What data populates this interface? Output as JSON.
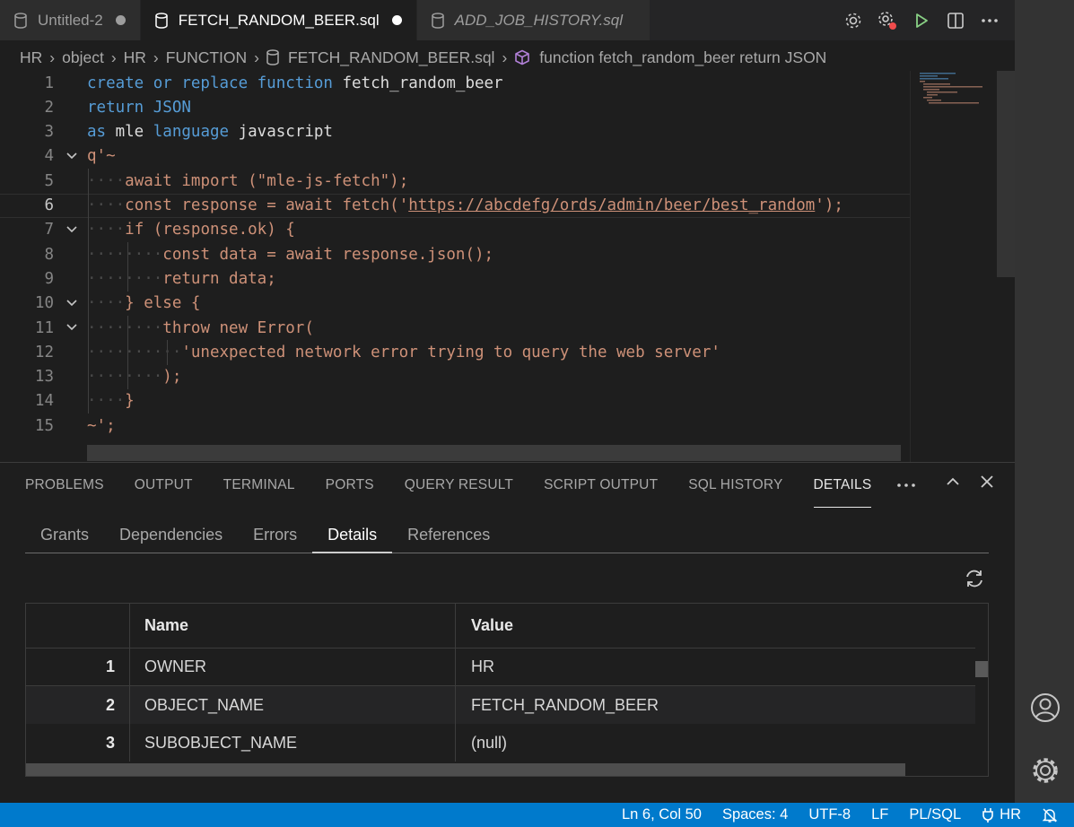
{
  "tabs": [
    {
      "label": "Untitled-2",
      "modified": true,
      "active": false,
      "italic": false
    },
    {
      "label": "FETCH_RANDOM_BEER.sql",
      "modified": true,
      "active": true,
      "italic": false
    },
    {
      "label": "ADD_JOB_HISTORY.sql",
      "modified": false,
      "active": false,
      "italic": true
    }
  ],
  "breadcrumb": {
    "items": [
      "HR",
      "object",
      "HR",
      "FUNCTION"
    ],
    "file": "FETCH_RANDOM_BEER.sql",
    "symbol": "function fetch_random_beer return JSON"
  },
  "editor": {
    "current_line": 6,
    "line_numbers": [
      "1",
      "2",
      "3",
      "4",
      "5",
      "6",
      "7",
      "8",
      "9",
      "10",
      "11",
      "12",
      "13",
      "14",
      "15"
    ],
    "lines": [
      [
        {
          "t": "create or replace function",
          "c": "kw"
        },
        {
          "t": " fetch_random_beer",
          "c": "id"
        }
      ],
      [
        {
          "t": "return JSON",
          "c": "kw"
        }
      ],
      [
        {
          "t": "as",
          "c": "kw"
        },
        {
          "t": " mle ",
          "c": "id"
        },
        {
          "t": "language",
          "c": "kw"
        },
        {
          "t": " javascript",
          "c": "id"
        }
      ],
      [
        {
          "t": "q'~",
          "c": "str"
        }
      ],
      [
        {
          "t": "····",
          "c": "ws"
        },
        {
          "t": "await import (\"mle-js-fetch\");",
          "c": "str"
        }
      ],
      [
        {
          "t": "····",
          "c": "ws"
        },
        {
          "t": "const response = await fetch('",
          "c": "str"
        },
        {
          "t": "https://abcdefg/ords/admin/beer/best_random",
          "c": "url"
        },
        {
          "t": "');",
          "c": "str"
        }
      ],
      [
        {
          "t": "····",
          "c": "ws"
        },
        {
          "t": "if (response.ok) {",
          "c": "str"
        }
      ],
      [
        {
          "t": "········",
          "c": "ws"
        },
        {
          "t": "const data = await response.json();",
          "c": "str"
        }
      ],
      [
        {
          "t": "········",
          "c": "ws"
        },
        {
          "t": "return data;",
          "c": "str"
        }
      ],
      [
        {
          "t": "····",
          "c": "ws"
        },
        {
          "t": "} else {",
          "c": "str"
        }
      ],
      [
        {
          "t": "········",
          "c": "ws"
        },
        {
          "t": "throw new Error(",
          "c": "str"
        }
      ],
      [
        {
          "t": "··········",
          "c": "ws"
        },
        {
          "t": "'unexpected network error trying to query the web server'",
          "c": "str"
        }
      ],
      [
        {
          "t": "········",
          "c": "ws"
        },
        {
          "t": ");",
          "c": "str"
        }
      ],
      [
        {
          "t": "····",
          "c": "ws"
        },
        {
          "t": "}",
          "c": "str"
        }
      ],
      [
        {
          "t": "~';",
          "c": "str"
        }
      ]
    ],
    "foldable_lines": [
      4,
      7,
      10,
      11
    ]
  },
  "panel": {
    "tabs": [
      "PROBLEMS",
      "OUTPUT",
      "TERMINAL",
      "PORTS",
      "QUERY RESULT",
      "SCRIPT OUTPUT",
      "SQL HISTORY",
      "DETAILS"
    ],
    "active_tab": "DETAILS",
    "sub_tabs": [
      "Grants",
      "Dependencies",
      "Errors",
      "Details",
      "References"
    ],
    "active_sub_tab": "Details",
    "grid": {
      "columns": [
        "",
        "Name",
        "Value"
      ],
      "rows": [
        {
          "num": "1",
          "name": "OWNER",
          "value": "HR"
        },
        {
          "num": "2",
          "name": "OBJECT_NAME",
          "value": "FETCH_RANDOM_BEER"
        },
        {
          "num": "3",
          "name": "SUBOBJECT_NAME",
          "value": "(null)"
        }
      ]
    }
  },
  "status": {
    "position": "Ln 6, Col 50",
    "spaces": "Spaces: 4",
    "encoding": "UTF-8",
    "eol": "LF",
    "language": "PL/SQL",
    "connection": "HR"
  },
  "colors": {
    "keyword": "#569cd6",
    "string": "#ce9178",
    "identifier": "#dcdcdc",
    "statusbar": "#007acc",
    "run": "#89d185"
  }
}
